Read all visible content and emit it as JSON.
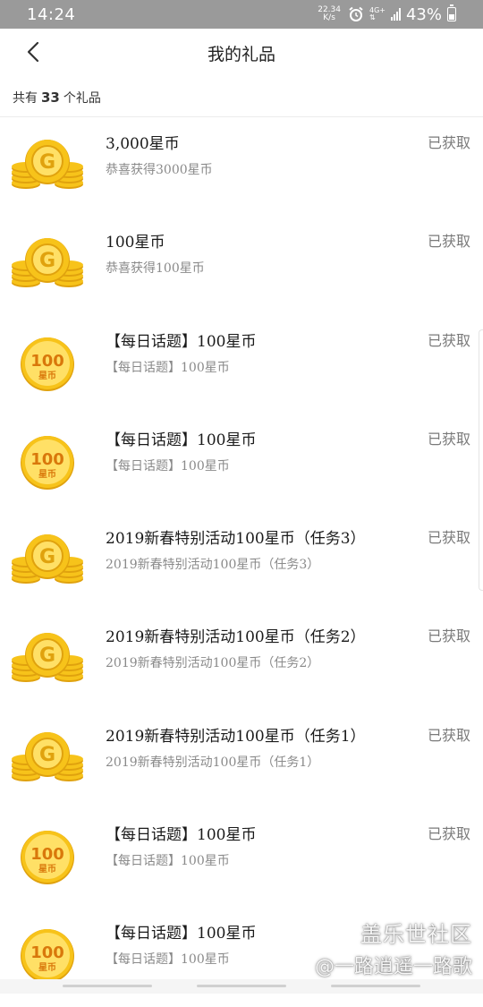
{
  "status_bar": {
    "time": "14:24",
    "net_speed_value": "22.34",
    "net_speed_unit": "K/s",
    "network": "4G+",
    "battery": "43%",
    "battery_level": 0.43
  },
  "header": {
    "title": "我的礼品"
  },
  "summary": {
    "prefix": "共有",
    "count": "33",
    "suffix": "个礼品"
  },
  "gifts": [
    {
      "icon": "gold-coin-stack-icon",
      "title": "3,000星币",
      "subtitle": "恭喜获得3000星币",
      "status": "已获取"
    },
    {
      "icon": "gold-coin-stack-icon",
      "title": "100星币",
      "subtitle": "恭喜获得100星币",
      "status": "已获取"
    },
    {
      "icon": "coin-100-icon",
      "coin_text": "100",
      "coin_unit": "星币",
      "title": "【每日话题】100星币",
      "subtitle": "【每日话题】100星币",
      "status": "已获取"
    },
    {
      "icon": "coin-100-icon",
      "coin_text": "100",
      "coin_unit": "星币",
      "title": "【每日话题】100星币",
      "subtitle": "【每日话题】100星币",
      "status": "已获取"
    },
    {
      "icon": "gold-coin-stack-icon",
      "title": "2019新春特别活动100星币（任务3）",
      "subtitle": "2019新春特别活动100星币（任务3）",
      "status": "已获取"
    },
    {
      "icon": "gold-coin-stack-icon",
      "title": "2019新春特别活动100星币（任务2）",
      "subtitle": "2019新春特别活动100星币（任务2）",
      "status": "已获取"
    },
    {
      "icon": "gold-coin-stack-icon",
      "title": "2019新春特别活动100星币（任务1）",
      "subtitle": "2019新春特别活动100星币（任务1）",
      "status": "已获取"
    },
    {
      "icon": "coin-100-icon",
      "coin_text": "100",
      "coin_unit": "星币",
      "title": "【每日话题】100星币",
      "subtitle": "【每日话题】100星币",
      "status": "已获取"
    },
    {
      "icon": "coin-100-icon",
      "coin_text": "100",
      "coin_unit": "星币",
      "title": "【每日话题】100星币",
      "subtitle": "【每日话题】100星币",
      "status": ""
    }
  ],
  "watermark": {
    "line1": "盖乐世社区",
    "line2": "@一路逍遥一路歌"
  },
  "colors": {
    "coin_gold": "#f7c31a",
    "coin_dark": "#e0a20e",
    "coin_light": "#ffe066"
  }
}
